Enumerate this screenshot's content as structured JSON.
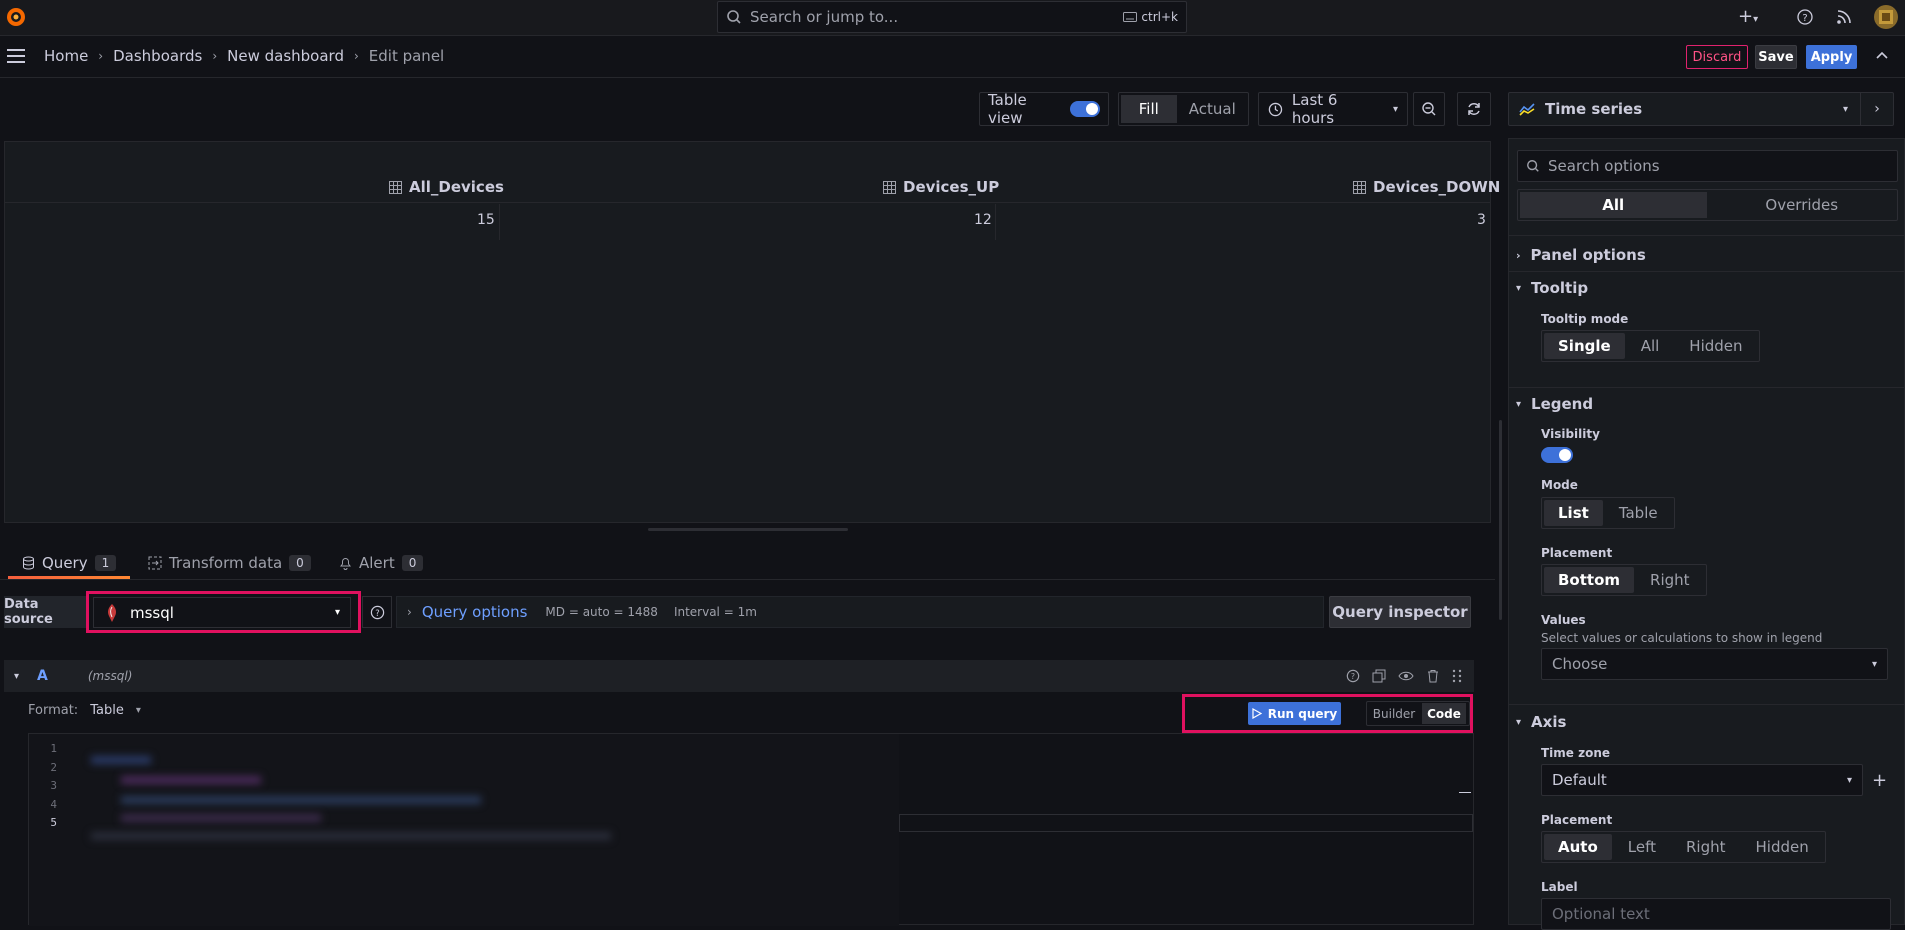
{
  "topbar": {
    "search_placeholder": "Search or jump to...",
    "search_shortcut": "ctrl+k"
  },
  "breadcrumb": [
    "Home",
    "Dashboards",
    "New dashboard",
    "Edit panel"
  ],
  "actions": {
    "discard": "Discard",
    "save": "Save",
    "apply": "Apply"
  },
  "toolbar": {
    "table_view": "Table view",
    "fill": "Fill",
    "actual": "Actual",
    "time_range": "Last 6 hours"
  },
  "table": {
    "columns": [
      "All_Devices",
      "Devices_UP",
      "Devices_DOWN"
    ],
    "row": [
      "15",
      "12",
      "3"
    ]
  },
  "tabs": [
    {
      "label": "Query",
      "count": "1"
    },
    {
      "label": "Transform data",
      "count": "0"
    },
    {
      "label": "Alert",
      "count": "0"
    }
  ],
  "query": {
    "data_source_label": "Data source",
    "data_source": "mssql",
    "query_options": "Query options",
    "md": "MD = auto = 1488",
    "interval": "Interval = 1m",
    "inspector": "Query inspector",
    "ref_id": "A",
    "ref_ds": "(mssql)",
    "format_label": "Format:",
    "format_value": "Table",
    "run_query": "Run query",
    "builder": "Builder",
    "code": "Code",
    "line_numbers": [
      "1",
      "2",
      "3",
      "4",
      "5"
    ]
  },
  "options": {
    "viz": "Time series",
    "search_placeholder": "Search options",
    "all": "All",
    "overrides": "Overrides",
    "panel_options": "Panel options",
    "tooltip": {
      "title": "Tooltip",
      "mode_label": "Tooltip mode",
      "modes": [
        "Single",
        "All",
        "Hidden"
      ]
    },
    "legend": {
      "title": "Legend",
      "visibility_label": "Visibility",
      "mode_label": "Mode",
      "modes": [
        "List",
        "Table"
      ],
      "placement_label": "Placement",
      "placements": [
        "Bottom",
        "Right"
      ],
      "values_label": "Values",
      "values_desc": "Select values or calculations to show in legend",
      "values_placeholder": "Choose"
    },
    "axis": {
      "title": "Axis",
      "timezone_label": "Time zone",
      "timezone_value": "Default",
      "placement_label": "Placement",
      "placements": [
        "Auto",
        "Left",
        "Right",
        "Hidden"
      ],
      "label_label": "Label",
      "label_placeholder": "Optional text"
    }
  }
}
